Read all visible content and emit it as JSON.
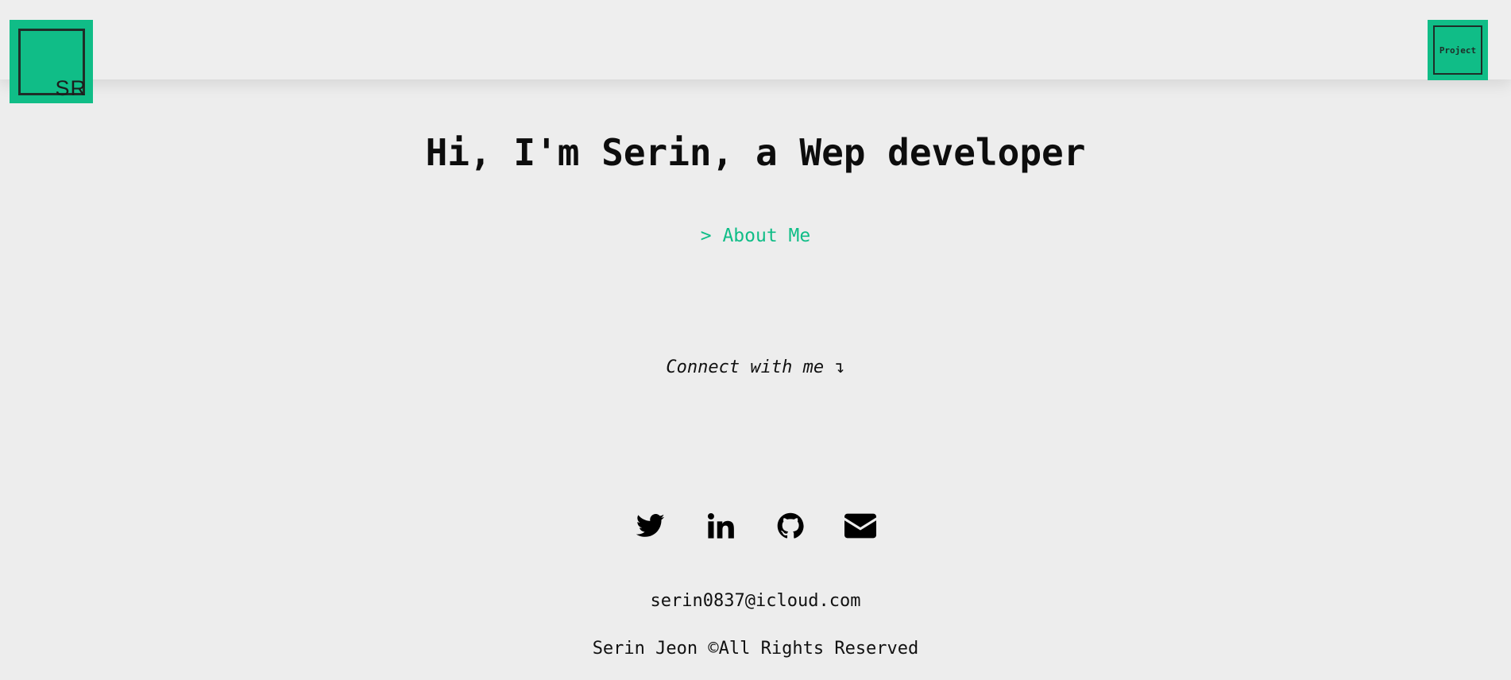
{
  "header": {
    "logo_text": "SR",
    "project_label": "Project"
  },
  "hero": {
    "title": "Hi, I'm Serin, a Wep developer",
    "about_link": "> About Me"
  },
  "connect": {
    "text": "Connect with me ↴"
  },
  "socials": [
    {
      "name": "twitter",
      "icon": "twitter-icon"
    },
    {
      "name": "linkedin",
      "icon": "linkedin-icon"
    },
    {
      "name": "github",
      "icon": "github-icon"
    },
    {
      "name": "email",
      "icon": "envelope-icon"
    }
  ],
  "footer": {
    "email": "serin0837@icloud.com",
    "copyright": "Serin Jeon ©All Rights Reserved"
  },
  "colors": {
    "accent": "#10bd87",
    "background": "#ededed",
    "text": "#111111"
  }
}
